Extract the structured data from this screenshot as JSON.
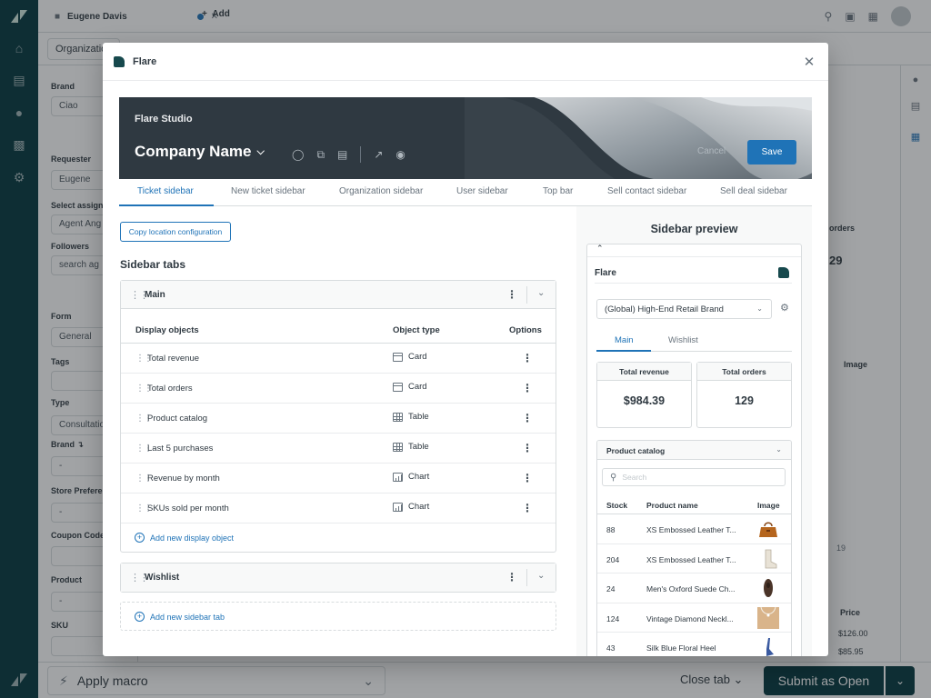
{
  "app": {
    "tab_title": "Eugene Davis",
    "add_label": "Add",
    "org_label": "Organization",
    "fields": [
      {
        "label": "Brand",
        "value": "Ciao"
      },
      {
        "label": "Requester",
        "value": "Eugene"
      },
      {
        "label": "Select assign",
        "value": "Agent Ang"
      },
      {
        "label": "Followers",
        "value": "search ag"
      },
      {
        "label": "Form",
        "value": "General"
      },
      {
        "label": "Tags",
        "value": ""
      },
      {
        "label": "Type",
        "value": "Consultatio"
      },
      {
        "label": "Brand ↴",
        "value": "-"
      },
      {
        "label": "Store Prefere",
        "value": "-"
      },
      {
        "label": "Coupon Code",
        "value": ""
      },
      {
        "label": "Product",
        "value": "-"
      },
      {
        "label": "SKU",
        "value": ""
      }
    ],
    "right_fragments": [
      "orders",
      "29",
      "Image",
      "19",
      "Price",
      "$126.00",
      "$85.95"
    ],
    "macro_label": "Apply macro",
    "close_tab_label": "Close tab",
    "submit_label": "Submit as Open"
  },
  "modal": {
    "title": "Flare",
    "studio_label": "Flare Studio",
    "company_name": "Company Name",
    "cancel_label": "Cancel",
    "save_label": "Save",
    "tabs": [
      "Ticket sidebar",
      "New ticket sidebar",
      "Organization sidebar",
      "User sidebar",
      "Top bar",
      "Sell contact sidebar",
      "Sell deal sidebar"
    ],
    "copy_label": "Copy location configuration",
    "section_title": "Sidebar tabs",
    "main_tab": {
      "name": "Main",
      "columns": [
        "Display objects",
        "Object type",
        "Options"
      ],
      "rows": [
        {
          "name": "Total revenue",
          "type": "Card",
          "icon": "card-icon"
        },
        {
          "name": "Total orders",
          "type": "Card",
          "icon": "card-icon"
        },
        {
          "name": "Product catalog",
          "type": "Table",
          "icon": "table-icon"
        },
        {
          "name": "Last 5 purchases",
          "type": "Table",
          "icon": "table-icon"
        },
        {
          "name": "Revenue by month",
          "type": "Chart",
          "icon": "chart-icon"
        },
        {
          "name": "SKUs sold per month",
          "type": "Chart",
          "icon": "chart-icon"
        }
      ],
      "add_object_label": "Add new display object"
    },
    "wishlist_tab": {
      "name": "Wishlist"
    },
    "add_tab_label": "Add new sidebar tab"
  },
  "preview": {
    "title": "Sidebar preview",
    "app_name": "Flare",
    "brand_select": "(Global) High-End Retail Brand",
    "tabs": [
      "Main",
      "Wishlist"
    ],
    "metrics": [
      {
        "label": "Total revenue",
        "value": "$984.39"
      },
      {
        "label": "Total orders",
        "value": "129"
      }
    ],
    "catalog": {
      "title": "Product catalog",
      "search_placeholder": "Search",
      "columns": [
        "Stock",
        "Product name",
        "Image"
      ],
      "rows": [
        {
          "stock": "88",
          "name": "XS Embossed Leather T...",
          "image": "handbag"
        },
        {
          "stock": "204",
          "name": "XS Embossed Leather T...",
          "image": "boot"
        },
        {
          "stock": "24",
          "name": "Men's Oxford Suede Ch...",
          "image": "oxford-shoe"
        },
        {
          "stock": "124",
          "name": "Vintage Diamond Neckl...",
          "image": "necklace"
        },
        {
          "stock": "43",
          "name": "Silk Blue Floral Heel",
          "image": "heel"
        }
      ]
    }
  },
  "colors": {
    "accent": "#1f73b7",
    "banner": "#2f3941",
    "nav": "#03363d"
  }
}
